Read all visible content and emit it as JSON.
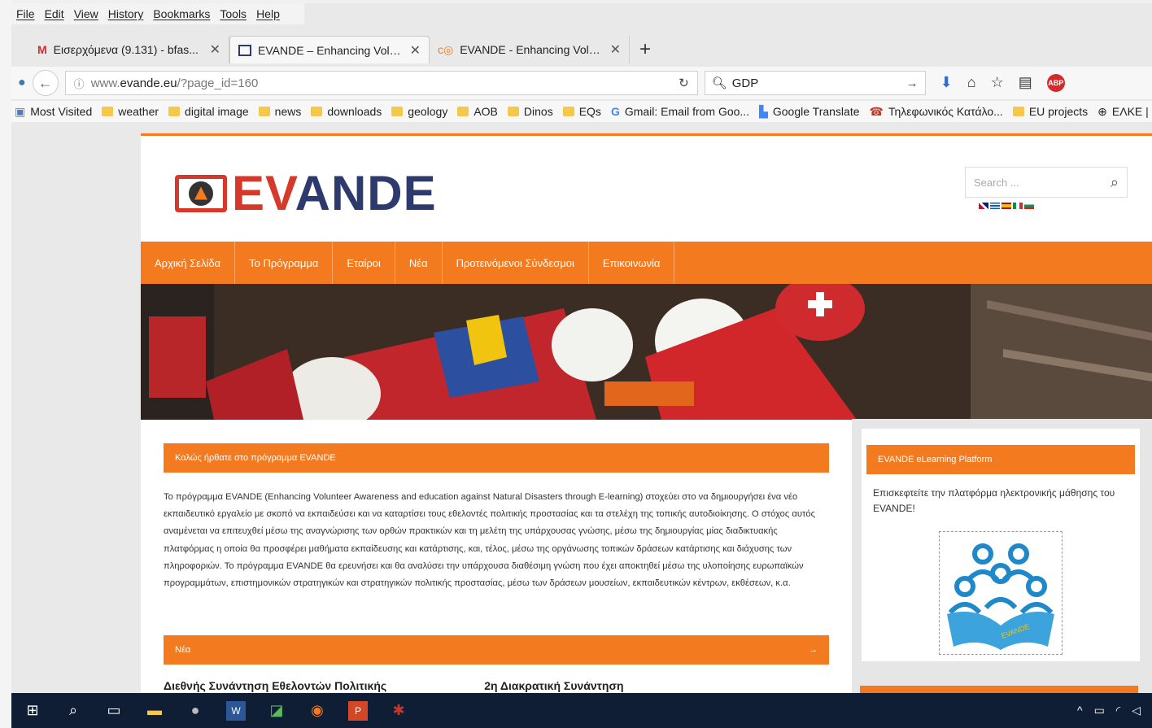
{
  "menu": [
    "File",
    "Edit",
    "View",
    "History",
    "Bookmarks",
    "Tools",
    "Help"
  ],
  "tabs": [
    {
      "icon": "gmail-icon",
      "title": "Εισερχόμενα (9.131) - bfas...",
      "active": false
    },
    {
      "icon": "evande-favicon-icon",
      "title": "EVANDE – Enhancing Volu...",
      "active": true
    },
    {
      "icon": "favicon-icon",
      "title": "EVANDE - Enhancing Volu...",
      "active": false
    }
  ],
  "newtab_label": "+",
  "url": {
    "prefix": "www.",
    "host": "evande.eu",
    "path": "/?page_id=160"
  },
  "search": {
    "value": "GDP"
  },
  "bookmarks": [
    {
      "icon": "most-visited-icon",
      "label": "Most Visited"
    },
    {
      "icon": "folder-icon",
      "label": "weather"
    },
    {
      "icon": "folder-icon",
      "label": "digital image"
    },
    {
      "icon": "folder-icon",
      "label": "news"
    },
    {
      "icon": "folder-icon",
      "label": "downloads"
    },
    {
      "icon": "folder-icon",
      "label": "geology"
    },
    {
      "icon": "folder-icon",
      "label": "AOB"
    },
    {
      "icon": "folder-icon",
      "label": "Dinos"
    },
    {
      "icon": "folder-icon",
      "label": "EQs"
    },
    {
      "icon": "google-icon",
      "label": "Gmail: Email from Goo..."
    },
    {
      "icon": "translate-icon",
      "label": "Google Translate"
    },
    {
      "icon": "phone-icon",
      "label": "Τηλεφωνικός Κατάλο..."
    },
    {
      "icon": "folder-icon",
      "label": "EU projects"
    },
    {
      "icon": "globe-icon",
      "label": "ΕΛΚΕ | Χρ"
    }
  ],
  "site": {
    "logo_letters": {
      "e": "E",
      "v": "V",
      "rest": "ANDE"
    },
    "search_placeholder": "Search ...",
    "nav": [
      "Αρχική Σελίδα",
      "Το Πρόγραμμα",
      "Εταίροι",
      "Νέα",
      "Προτεινόμενοι Σύνδεσμοι",
      "Επικοινωνία"
    ],
    "welcome_title": "Καλώς ήρθατε στο πρόγραμμα EVANDE",
    "welcome_text": "Το πρόγραμμα EVANDE (Enhancing Volunteer Awareness and education against Natural Disasters through E-learning) στοχεύει στο να δημιουργήσει ένα νέο εκπαιδευτικό εργαλείο με σκοπό να εκπαιδεύσει και να καταρτίσει τους εθελοντές πολιτικής προστασίας και τα στελέχη της τοπικής αυτοδιοίκησης. Ο στόχος αυτός αναμένεται να επιτευχθεί μέσω της αναγνώρισης των ορθών πρακτικών και τη μελέτη της υπάρχουσας γνώσης, μέσω της δημιουργίας μίας διαδικτυακής πλατφόρμας η οποία θα προσφέρει μαθήματα εκπαίδευσης και κατάρτισης, και, τέλος, μέσω της οργάνωσης τοπικών δράσεων κατάρτισης και διάχυσης των πληροφοριών. Το πρόγραμμα EVANDE θα ερευνήσει και θα αναλύσει την υπάρχουσα διαθέσιμη γνώση που έχει αποκτηθεί μέσω της υλοποίησης ευρωπαϊκών προγραμμάτων, επιστημονικών στρατηγικών και στρατηγικών πολιτικής προστασίας, μέσω των δράσεων μουσείων, εκπαιδευτικών κέντρων, εκθέσεων, κ.α.",
    "news_title": "Νέα",
    "news_arrow": "→",
    "headline_1": "Διεθνής Συνάντηση Εθελοντών Πολιτικής",
    "headline_2": "2η Διακρατική Συνάντηση",
    "sidebar_title": "EVANDE eLearning Platform",
    "sidebar_text": "Επισκεφτείτε την πλατφόρμα ηλεκτρονικής μάθησης του EVANDE!",
    "elearning_book_label": "EVANDE"
  },
  "colors": {
    "accent": "#f47a20",
    "logo_navy": "#2c3a6e",
    "logo_red": "#d6392a",
    "taskbar": "#0f1d35"
  }
}
